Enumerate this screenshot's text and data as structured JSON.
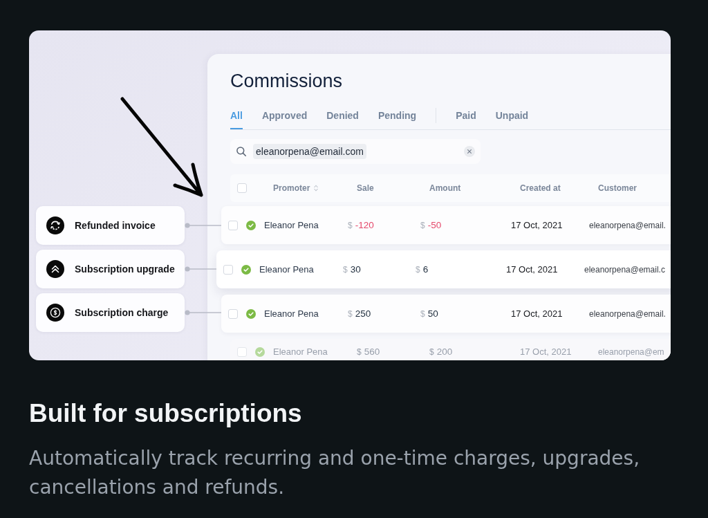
{
  "callouts": [
    {
      "kind": "refund",
      "label": "Refunded invoice"
    },
    {
      "kind": "upgrade",
      "label": "Subscription upgrade"
    },
    {
      "kind": "charge",
      "label": "Subscription charge"
    }
  ],
  "commissions_panel": {
    "title": "Commissions",
    "tab_groups": [
      {
        "tabs": [
          {
            "label": "All",
            "selected": true
          },
          {
            "label": "Approved",
            "selected": false
          },
          {
            "label": "Denied",
            "selected": false
          },
          {
            "label": "Pending",
            "selected": false
          }
        ]
      },
      {
        "tabs": [
          {
            "label": "Paid",
            "selected": false
          },
          {
            "label": "Unpaid",
            "selected": false
          }
        ]
      }
    ],
    "search": {
      "value": "eleanorpena@email.com"
    },
    "table": {
      "header_checked": false,
      "columns": [
        {
          "label": "Promoter",
          "sortable": true
        },
        {
          "label": "Sale",
          "sortable": false
        },
        {
          "label": "Amount",
          "sortable": false
        },
        {
          "label": "Created at",
          "sortable": false
        },
        {
          "label": "Customer",
          "sortable": false
        }
      ],
      "rows": [
        {
          "kind": "lifted",
          "checked": false,
          "approved": true,
          "promoter": "Eleanor Pena",
          "sale": {
            "currency": "$",
            "value": "-120"
          },
          "amount": {
            "currency": "$",
            "value": "-50"
          },
          "negative": true,
          "created_at": "17 Oct, 2021",
          "customer": "eleanorpena@email."
        },
        {
          "kind": "focused",
          "checked": false,
          "approved": true,
          "promoter": "Eleanor Pena",
          "sale": {
            "currency": "$",
            "value": "30"
          },
          "amount": {
            "currency": "$",
            "value": "6"
          },
          "negative": false,
          "created_at": "17 Oct, 2021",
          "customer": "eleanorpena@email.c"
        },
        {
          "kind": "lifted",
          "checked": false,
          "approved": true,
          "promoter": "Eleanor Pena",
          "sale": {
            "currency": "$",
            "value": "250"
          },
          "amount": {
            "currency": "$",
            "value": "50"
          },
          "negative": false,
          "created_at": "17 Oct, 2021",
          "customer": "eleanorpena@email."
        },
        {
          "kind": "faded",
          "checked": false,
          "approved": true,
          "promoter": "Eleanor Pena",
          "sale": {
            "currency": "$",
            "value": "560"
          },
          "amount": {
            "currency": "$",
            "value": "200"
          },
          "negative": false,
          "created_at": "17 Oct, 2021",
          "customer": "eleanorpena@em"
        }
      ]
    }
  },
  "feature": {
    "heading": "Built for subscriptions",
    "description": "Automatically track recurring and one-time charges, upgrades, cancellations and refunds."
  }
}
